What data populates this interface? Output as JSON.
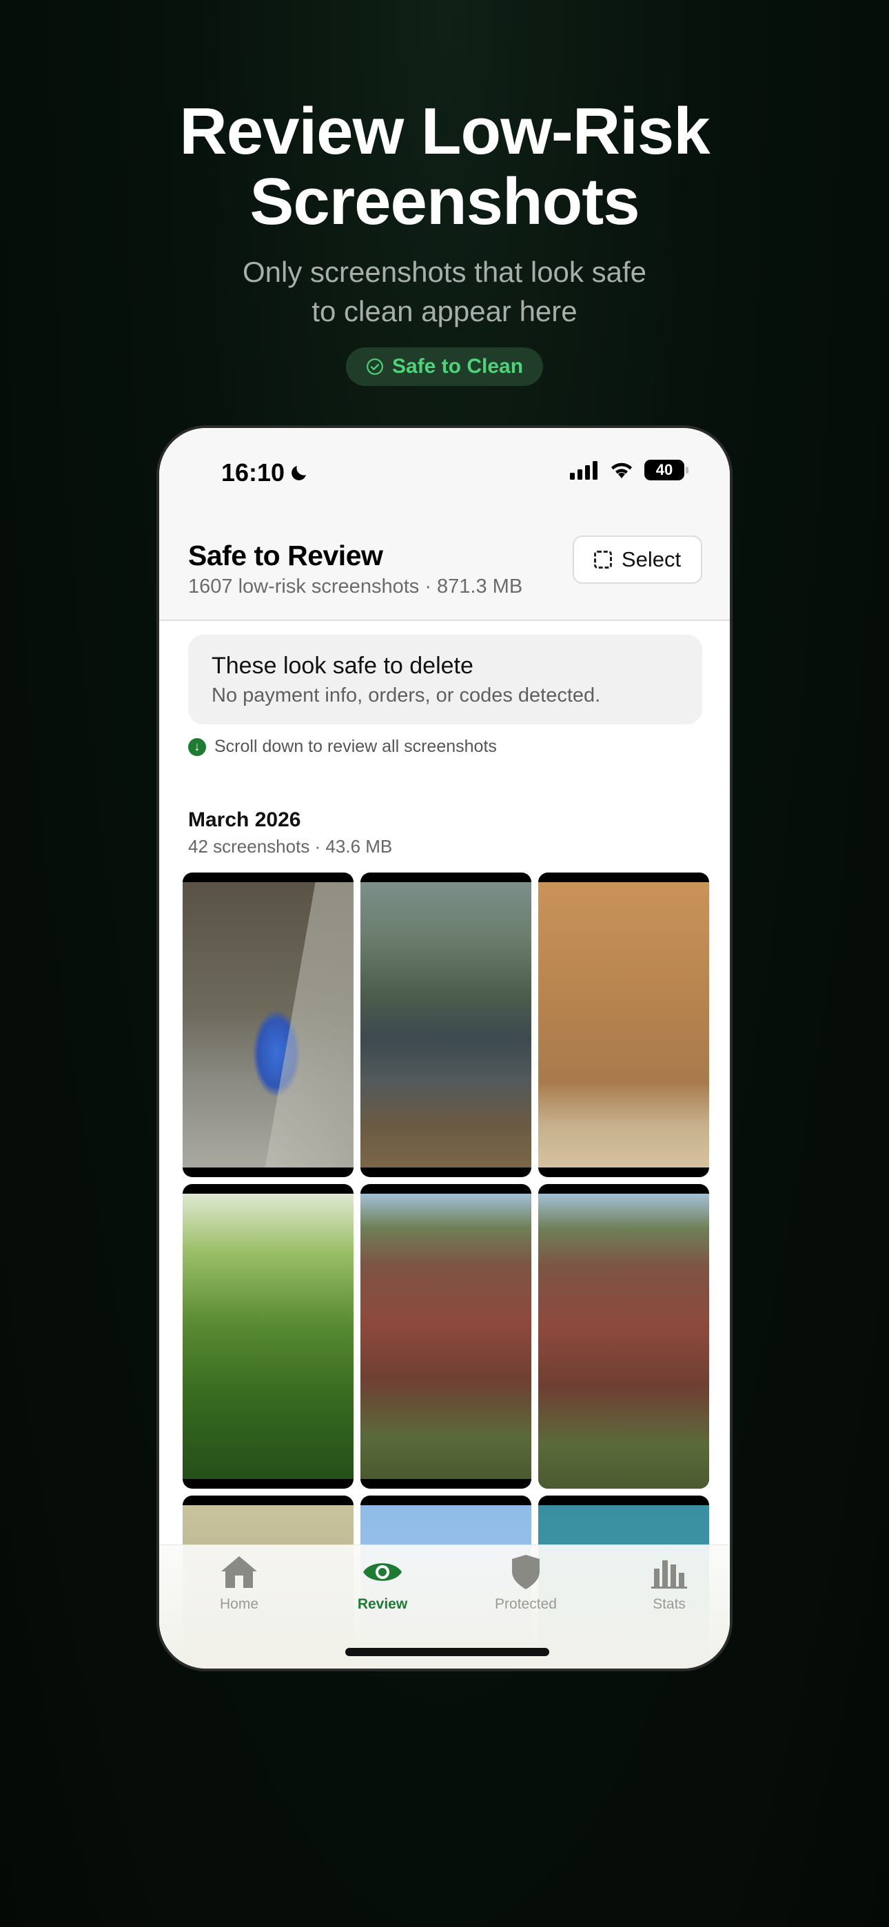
{
  "hero": {
    "title": "Review Low-Risk Screenshots",
    "subtitle_line1": "Only screenshots that look safe",
    "subtitle_line2": "to clean appear here",
    "pill_label": "Safe to Clean"
  },
  "status_bar": {
    "time": "16:10",
    "battery": "40"
  },
  "header": {
    "title": "Safe to Review",
    "subtitle": "1607 low-risk screenshots · 871.3 MB",
    "select_label": "Select"
  },
  "notice": {
    "title": "These look safe to delete",
    "subtitle": "No payment info, orders, or codes detected."
  },
  "scroll_hint": "Scroll down to review all screenshots",
  "section": {
    "title": "March 2026",
    "subtitle": "42 screenshots · 43.6 MB"
  },
  "tabs": [
    {
      "label": "Home",
      "icon": "home-icon",
      "active": false
    },
    {
      "label": "Review",
      "icon": "eye-icon",
      "active": true
    },
    {
      "label": "Protected",
      "icon": "shield-icon",
      "active": false
    },
    {
      "label": "Stats",
      "icon": "bar-chart-icon",
      "active": false
    }
  ],
  "colors": {
    "accent": "#1f7a34",
    "pill_text": "#4fd27a",
    "background": "#07120c"
  }
}
